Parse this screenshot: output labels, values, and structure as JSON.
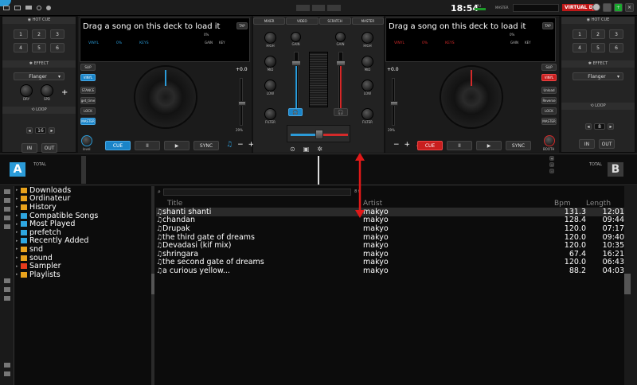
{
  "topbar": {
    "clock": "18:54",
    "cpu_label": "CPU",
    "master_label": "MASTER",
    "brand": "VIRTUAL DJ"
  },
  "left_panel": {
    "hot_cue_title": "HOT CUE",
    "hot_cues": [
      "1",
      "2",
      "3",
      "4",
      "5",
      "6"
    ],
    "effect_title": "EFFECT",
    "effect_name": "Flanger",
    "effect_knobs": [
      "DRY",
      "SPD"
    ],
    "loop_title": "LOOP",
    "loop_value": "16",
    "in_label": "IN",
    "out_label": "OUT"
  },
  "right_panel": {
    "hot_cue_title": "HOT CUE",
    "hot_cues": [
      "1",
      "2",
      "3",
      "4",
      "5",
      "6"
    ],
    "effect_title": "EFFECT",
    "effect_name": "Flanger",
    "loop_title": "LOOP",
    "loop_value": "8",
    "in_label": "IN",
    "out_label": "OUT"
  },
  "deck_a": {
    "title": "Drag a song on this deck to load it",
    "tap": "TAP",
    "info": [
      "VINYL",
      "0%",
      "KEYS"
    ],
    "gain": "GAIN",
    "key": "KEY",
    "pitch": "+0.0",
    "pitch_pct": "29%",
    "side_buttons": [
      "SLIP",
      "VINYL",
      "STANCE",
      "get_time",
      "LOCK",
      "MASTER"
    ],
    "knob_label": "level",
    "cue": "CUE",
    "pause": "II",
    "play": "▶",
    "sync": "SYNC",
    "letter": "A",
    "total": "TOTAL"
  },
  "deck_b": {
    "title": "Drag a song on this deck to load it",
    "tap": "TAP",
    "info": [
      "VINYL",
      "0%",
      "KEYS"
    ],
    "gain": "GAIN",
    "key": "KEY",
    "pitch": "+0.0",
    "pitch_pct": "29%",
    "side_buttons": [
      "SLIP",
      "VINYL",
      "Unload",
      "Reverse",
      "LOCK",
      "MASTER"
    ],
    "knob_label": "BOOTH",
    "cue": "CUE",
    "pause": "II",
    "play": "▶",
    "sync": "SYNC",
    "letter": "B",
    "total": "TOTAL"
  },
  "mixer": {
    "tabs": [
      "MIXER",
      "VIDEO",
      "SCRATCH",
      "MASTER"
    ],
    "gain": "GAIN",
    "eq": [
      "HIGH",
      "MID",
      "LOW"
    ],
    "filter": "FILTER"
  },
  "browser": {
    "folders": [
      {
        "name": "Downloads",
        "color": "#e8a21c"
      },
      {
        "name": "Ordinateur",
        "color": "#e8a21c"
      },
      {
        "name": "History",
        "color": "#e8a21c"
      },
      {
        "name": "Compatible Songs",
        "color": "#2ea6e0"
      },
      {
        "name": "Most Played",
        "color": "#2ea6e0"
      },
      {
        "name": "prefetch",
        "color": "#2ea6e0"
      },
      {
        "name": "Recently Added",
        "color": "#2ea6e0"
      },
      {
        "name": "snd",
        "color": "#e8a21c"
      },
      {
        "name": "sound",
        "color": "#e8a21c"
      },
      {
        "name": "Sampler",
        "color": "#e83c1c"
      },
      {
        "name": "Playlists",
        "color": "#e8a21c"
      }
    ],
    "search_count": "8 fi",
    "headers": {
      "title": "Title",
      "artist": "Artist",
      "bpm": "Bpm",
      "length": "Length"
    },
    "rows": [
      {
        "title": "shanti shanti",
        "artist": "makyo",
        "bpm": "131.3",
        "length": "12:01"
      },
      {
        "title": "chandan",
        "artist": "makyo",
        "bpm": "128.4",
        "length": "09:44"
      },
      {
        "title": "Drupak",
        "artist": "makyo",
        "bpm": "120.0",
        "length": "07:17"
      },
      {
        "title": "the third gate of dreams",
        "artist": "makyo",
        "bpm": "120.0",
        "length": "09:40"
      },
      {
        "title": "Devadasi (kif mix)",
        "artist": "makyo",
        "bpm": "120.0",
        "length": "10:35"
      },
      {
        "title": "shringara",
        "artist": "makyo",
        "bpm": "67.4",
        "length": "16:21"
      },
      {
        "title": "the second gate of dreams",
        "artist": "makyo",
        "bpm": "120.0",
        "length": "06:43"
      },
      {
        "title": "a curious yellow...",
        "artist": "makyo",
        "bpm": "88.2",
        "length": "04:03"
      }
    ]
  }
}
